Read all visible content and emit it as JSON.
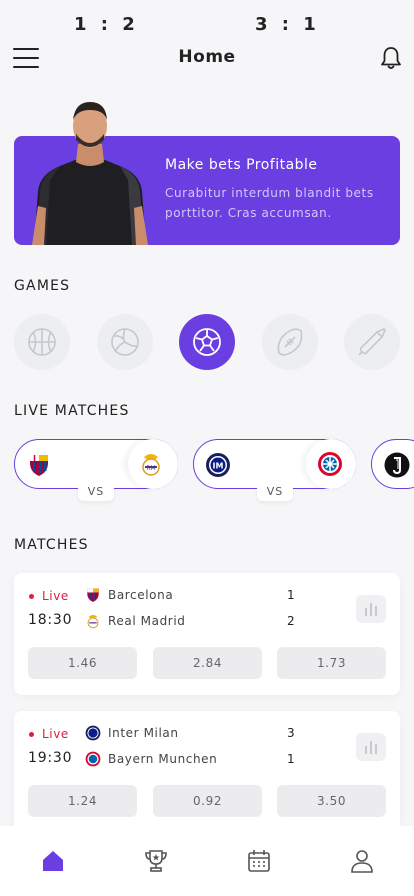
{
  "header": {
    "title": "Home",
    "menu_icon": "hamburger-menu-icon",
    "bell_icon": "bell-icon"
  },
  "banner": {
    "title": "Make bets Profitable",
    "text": "Curabitur interdum blandit bets porttitor. Cras accumsan.",
    "color": "#6a3ee0"
  },
  "games": {
    "title": "GAMES",
    "items": [
      {
        "icon": "basketball-icon",
        "active": false
      },
      {
        "icon": "volleyball-icon",
        "active": false
      },
      {
        "icon": "soccer-ball-icon",
        "active": true
      },
      {
        "icon": "american-football-icon",
        "active": false
      },
      {
        "icon": "badminton-shuttlecock-icon",
        "active": false
      }
    ]
  },
  "live_matches": {
    "title": "LIVE MATCHES",
    "items": [
      {
        "home_crest": "barcelona-crest-icon",
        "away_crest": "real-madrid-crest-icon",
        "score": "1 : 2",
        "vs": "VS"
      },
      {
        "home_crest": "inter-milan-crest-icon",
        "away_crest": "bayern-munchen-crest-icon",
        "score": "3 : 1",
        "vs": "VS"
      },
      {
        "home_crest": "juventus-crest-icon"
      }
    ]
  },
  "matches": {
    "title": "MATCHES",
    "items": [
      {
        "status": "Live",
        "time": "18:30",
        "home": {
          "name": "Barcelona",
          "score": "1",
          "crest": "barcelona-crest-icon"
        },
        "away": {
          "name": "Real Madrid",
          "score": "2",
          "crest": "real-madrid-crest-icon"
        },
        "odds": [
          "1.46",
          "2.84",
          "1.73"
        ]
      },
      {
        "status": "Live",
        "time": "19:30",
        "home": {
          "name": "Inter Milan",
          "score": "3",
          "crest": "inter-milan-crest-icon"
        },
        "away": {
          "name": "Bayern Munchen",
          "score": "1",
          "crest": "bayern-munchen-crest-icon"
        },
        "odds": [
          "1.24",
          "0.92",
          "3.50"
        ]
      }
    ]
  },
  "tabbar": {
    "items": [
      {
        "icon": "home-icon",
        "active": true
      },
      {
        "icon": "trophy-icon",
        "active": false
      },
      {
        "icon": "calendar-icon",
        "active": false
      },
      {
        "icon": "profile-icon",
        "active": false
      }
    ]
  },
  "colors": {
    "accent": "#6a3ee0",
    "live": "#d9213b",
    "background": "#f6f6f8"
  }
}
